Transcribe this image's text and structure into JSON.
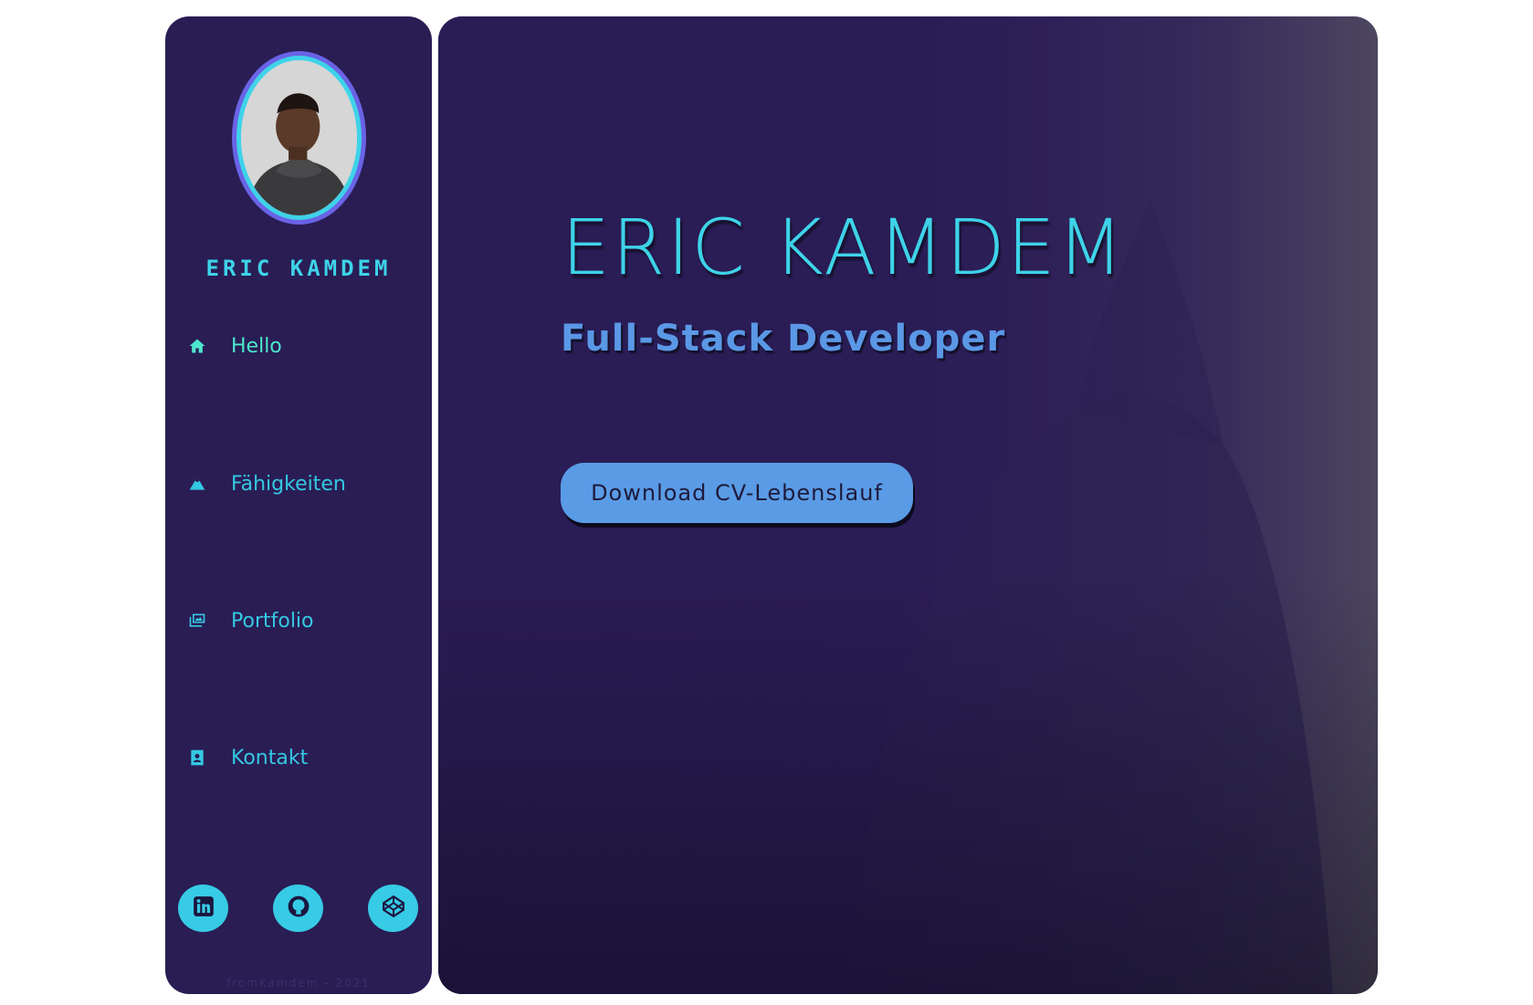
{
  "sidebar": {
    "name": "ERIC KAMDEM",
    "nav": [
      {
        "label": "Hello",
        "icon": "home-icon"
      },
      {
        "label": "Fähigkeiten",
        "icon": "mountain-icon"
      },
      {
        "label": "Portfolio",
        "icon": "images-icon"
      },
      {
        "label": "Kontakt",
        "icon": "contact-card-icon"
      }
    ],
    "social": [
      "linkedin-icon",
      "github-icon",
      "codepen-icon"
    ],
    "footer": "fromKamdem - 2021"
  },
  "hero": {
    "title": "ERIC KAMDEM",
    "subtitle": "Full-Stack Developer",
    "button": "Download CV-Lebenslauf"
  },
  "colors": {
    "panel": "#291d54",
    "accent": "#3ed3e8",
    "active": "#4ee6cc",
    "button": "#5a9be6"
  }
}
